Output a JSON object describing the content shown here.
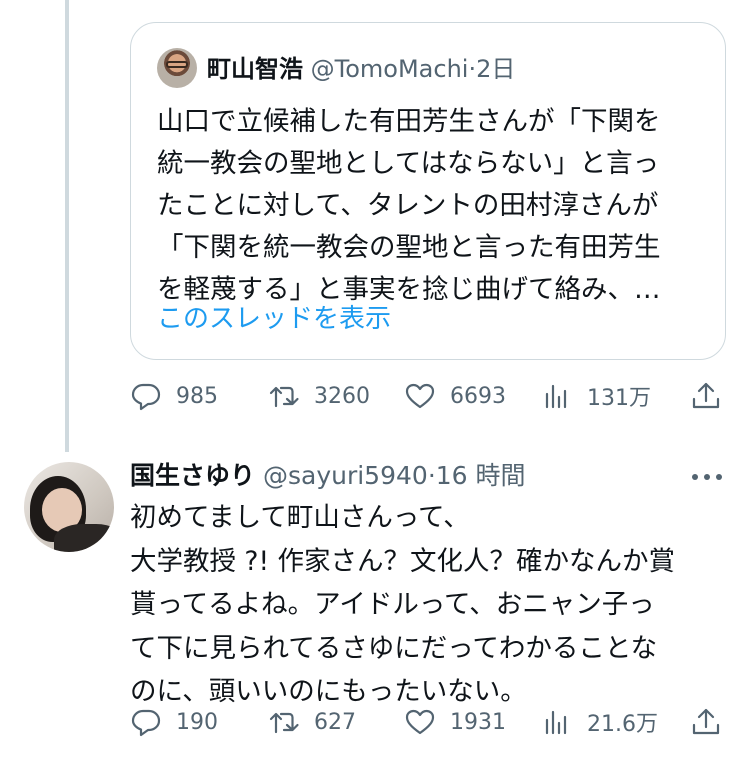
{
  "quoted_tweet": {
    "name": "町山智浩",
    "handle": "@TomoMachi",
    "separator": "·",
    "time": "2日",
    "text": "山口で立候補した有田芳生さんが「下関を\n統一教会の聖地としてはならない」と言っ\nたことに対して、タレントの田村淳さんが\n「下関を統一教会の聖地と言った有田芳生\nを軽蔑する」と事実を捻じ曲げて絡み、…",
    "show_thread": "このスレッドを表示"
  },
  "tweet1_actions": {
    "replies": "985",
    "retweets": "3260",
    "likes": "6693",
    "views": "131万"
  },
  "tweet2": {
    "name": "国生さゆり",
    "handle": "@sayuri5940",
    "separator": "·",
    "time": "16 時間",
    "text": "初めてまして町山さんって、\n大学教授 ?! 作家さん？文化人？確かなんか賞\n貰ってるよね。アイドルって、おニャン子っ\nて下に見られてるさゆにだってわかることな\nのに、頭いいのにもったいない。"
  },
  "tweet2_actions": {
    "replies": "190",
    "retweets": "627",
    "likes": "1931",
    "views": "21.6万"
  },
  "icons": {
    "reply": "reply-icon",
    "retweet": "retweet-icon",
    "like": "heart-icon",
    "views": "views-icon",
    "share": "share-icon",
    "more": "more-icon"
  },
  "colors": {
    "link": "#1d9bf0",
    "secondary_text": "#536471",
    "border": "#cfd9de"
  }
}
